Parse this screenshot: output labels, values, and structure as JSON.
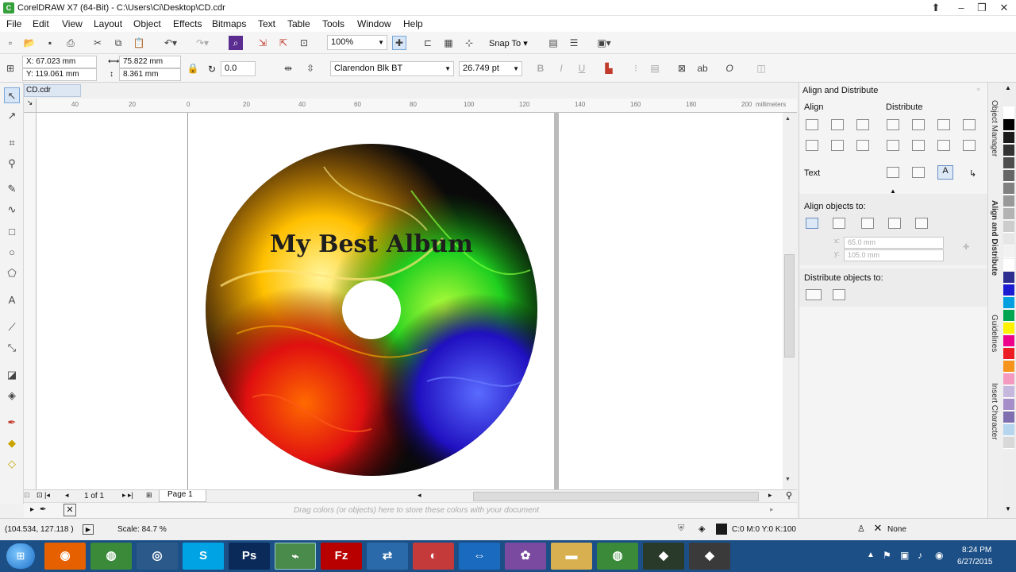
{
  "window": {
    "title": "CorelDRAW X7 (64-Bit) - C:\\Users\\Ci\\Desktop\\CD.cdr"
  },
  "menu": [
    "File",
    "Edit",
    "View",
    "Layout",
    "Object",
    "Effects",
    "Bitmaps",
    "Text",
    "Table",
    "Tools",
    "Window",
    "Help"
  ],
  "toolbar": {
    "zoom": "100%",
    "snap_to": "Snap To"
  },
  "propbar": {
    "x": "X: 67.023 mm",
    "y": "Y: 119.061 mm",
    "w": "75.822 mm",
    "h": "8.361 mm",
    "rotation": "0.0",
    "font": "Clarendon Blk BT",
    "font_size": "26.749 pt"
  },
  "document": {
    "tab": "CD.cdr",
    "ruler_ticks": [
      "40",
      "20",
      "0",
      "20",
      "40",
      "60",
      "80",
      "100",
      "120",
      "140",
      "160",
      "180",
      "200"
    ],
    "ruler_unit": "millimeters",
    "cd_text": "My Best Album"
  },
  "page_nav": {
    "count": "1 of 1",
    "page_tab": "Page 1"
  },
  "color_hint": "Drag colors (or objects) here to store these colors with your document",
  "panel": {
    "title": "Align and Distribute",
    "align_label": "Align",
    "distribute_label": "Distribute",
    "text_label": "Text",
    "align_to_label": "Align objects to:",
    "x_val": "65.0 mm",
    "y_val": "105.0 mm",
    "distribute_to_label": "Distribute objects to:"
  },
  "side_tabs": [
    "Object Manager",
    "Align and Distribute",
    "Guidelines",
    "Insert Character"
  ],
  "palette_colors": [
    "#ffffff",
    "#000000",
    "#1a1a1a",
    "#333333",
    "#4d4d4d",
    "#666666",
    "#808080",
    "#999999",
    "#b3b3b3",
    "#cccccc",
    "#e6e6e6",
    "#f2f2f2",
    "#ffffff",
    "#2d2d8f",
    "#1b1bd1",
    "#00a0e0",
    "#00a651",
    "#fff200",
    "#ec008c",
    "#ed1c24",
    "#f7941d",
    "#f49ac1",
    "#c6b7de",
    "#a68fc8",
    "#7f6fb0",
    "#b5d6ee",
    "#d8d8d8"
  ],
  "status": {
    "coords": "(104.534, 127.118 )",
    "scale": "Scale: 84.7 %",
    "fill": "C:0 M:0 Y:0 K:100",
    "outline": "None"
  },
  "taskbar": {
    "apps": [
      "firefox",
      "chrome",
      "scanner",
      "skype",
      "photoshop",
      "coreldraw",
      "filezilla",
      "network",
      "ccleaner",
      "teamviewer",
      "paint",
      "explorer",
      "chrome2",
      "app1",
      "app2"
    ],
    "time": "8:24 PM",
    "date": "6/27/2015"
  }
}
